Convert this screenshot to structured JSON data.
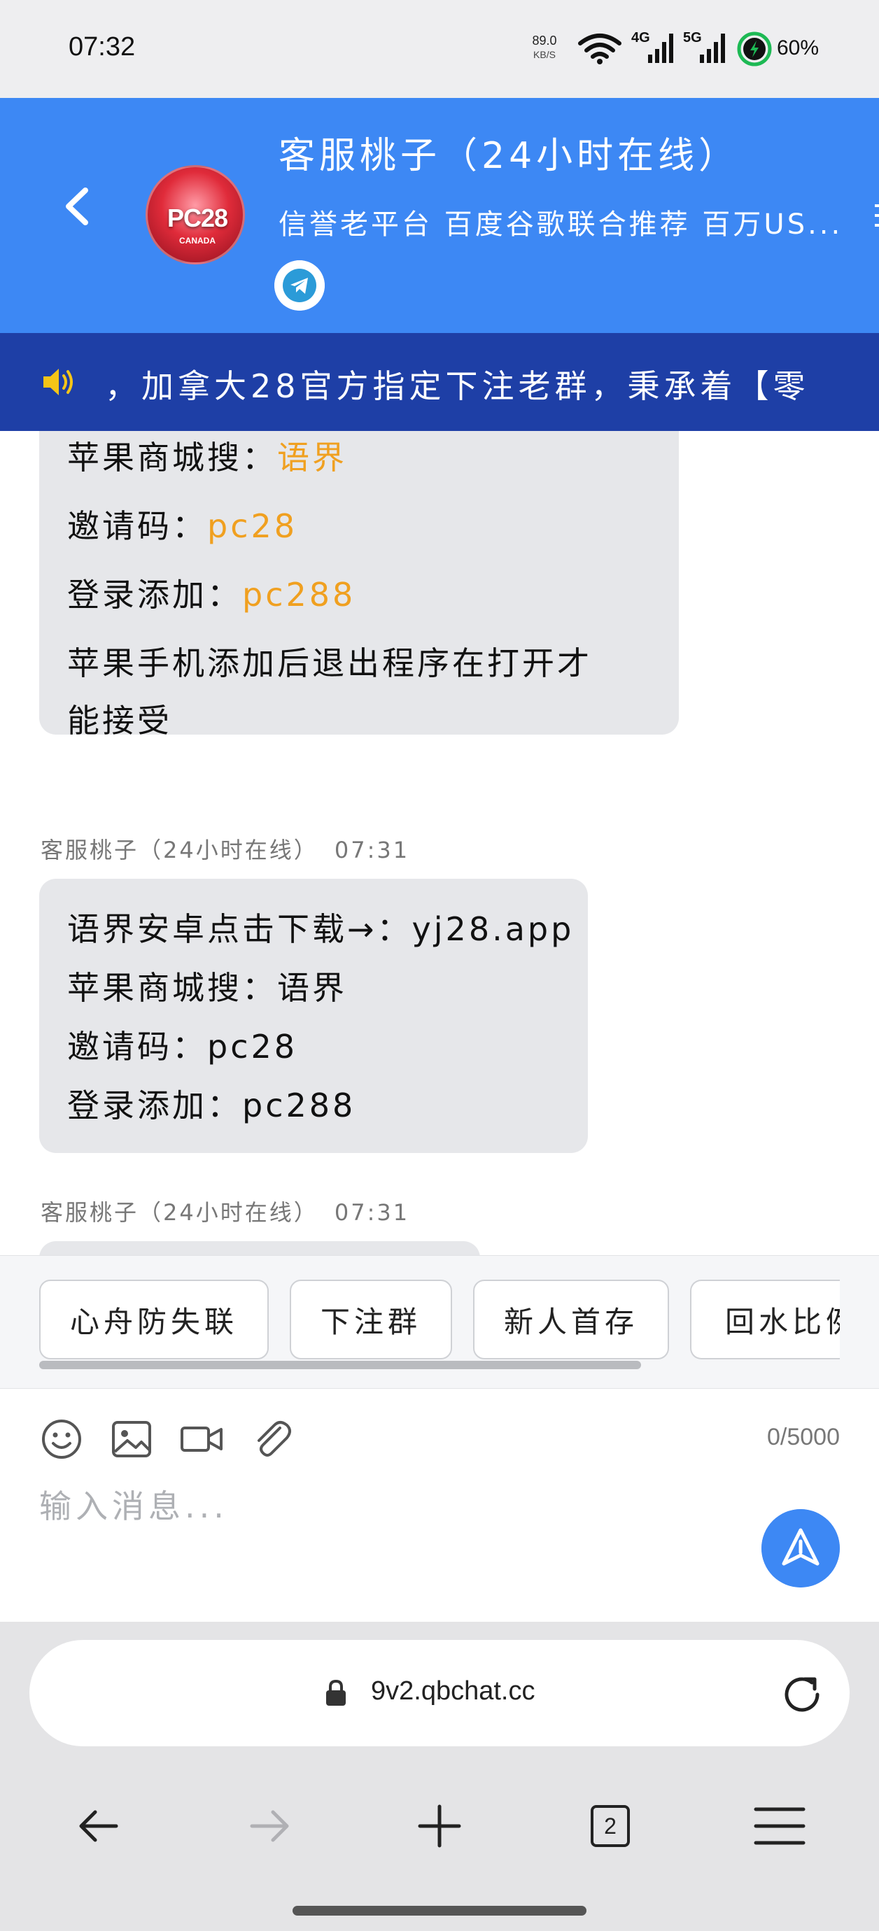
{
  "status_bar": {
    "time": "07:32",
    "net_speed": "89.0",
    "net_unit": "KB/S",
    "signal_1": "4G",
    "signal_2": "5G",
    "battery": "60%"
  },
  "header": {
    "title": "客服桃子（24小时在线）",
    "subtitle": "信誉老平台 百度谷歌联合推荐 百万US...",
    "avatar_label": "PC28",
    "avatar_sub": "CANADA"
  },
  "announcement": {
    "text": "，加拿大28官方指定下注老群，秉承着【零"
  },
  "messages": [
    {
      "lines": [
        {
          "label": "苹果商城搜：",
          "value": "语界"
        },
        {
          "label": "邀请码：",
          "value": "pc28"
        },
        {
          "label": "登录添加：",
          "value": "pc288"
        },
        {
          "label": "苹果手机添加后退出程序在打开才",
          "value": ""
        },
        {
          "label": "能接受",
          "value": ""
        }
      ]
    },
    {
      "sender": "客服桃子（24小时在线）",
      "time": "07:31",
      "lines": [
        {
          "label": "语界安卓点击下载→：yj28.app"
        },
        {
          "label": "苹果商城搜：语界"
        },
        {
          "label": "邀请码：pc28"
        },
        {
          "label": "登录添加：pc288"
        }
      ]
    },
    {
      "sender": "客服桃子（24小时在线）",
      "time": "07:31"
    }
  ],
  "quick_replies": [
    "心舟防失联",
    "下注群",
    "新人首存",
    "回水比例"
  ],
  "composer": {
    "char_count": "0/5000",
    "placeholder": "输入消息...",
    "icons": [
      "emoji-icon",
      "image-icon",
      "video-icon",
      "attachment-icon"
    ]
  },
  "browser": {
    "url": "9v2.qbchat.cc",
    "tab_count": "2"
  },
  "colors": {
    "header_blue": "#3d88f4",
    "announcement_navy": "#1e3fa6",
    "accent_orange": "#f0a020",
    "bubble_gray": "#e6e7ea"
  }
}
